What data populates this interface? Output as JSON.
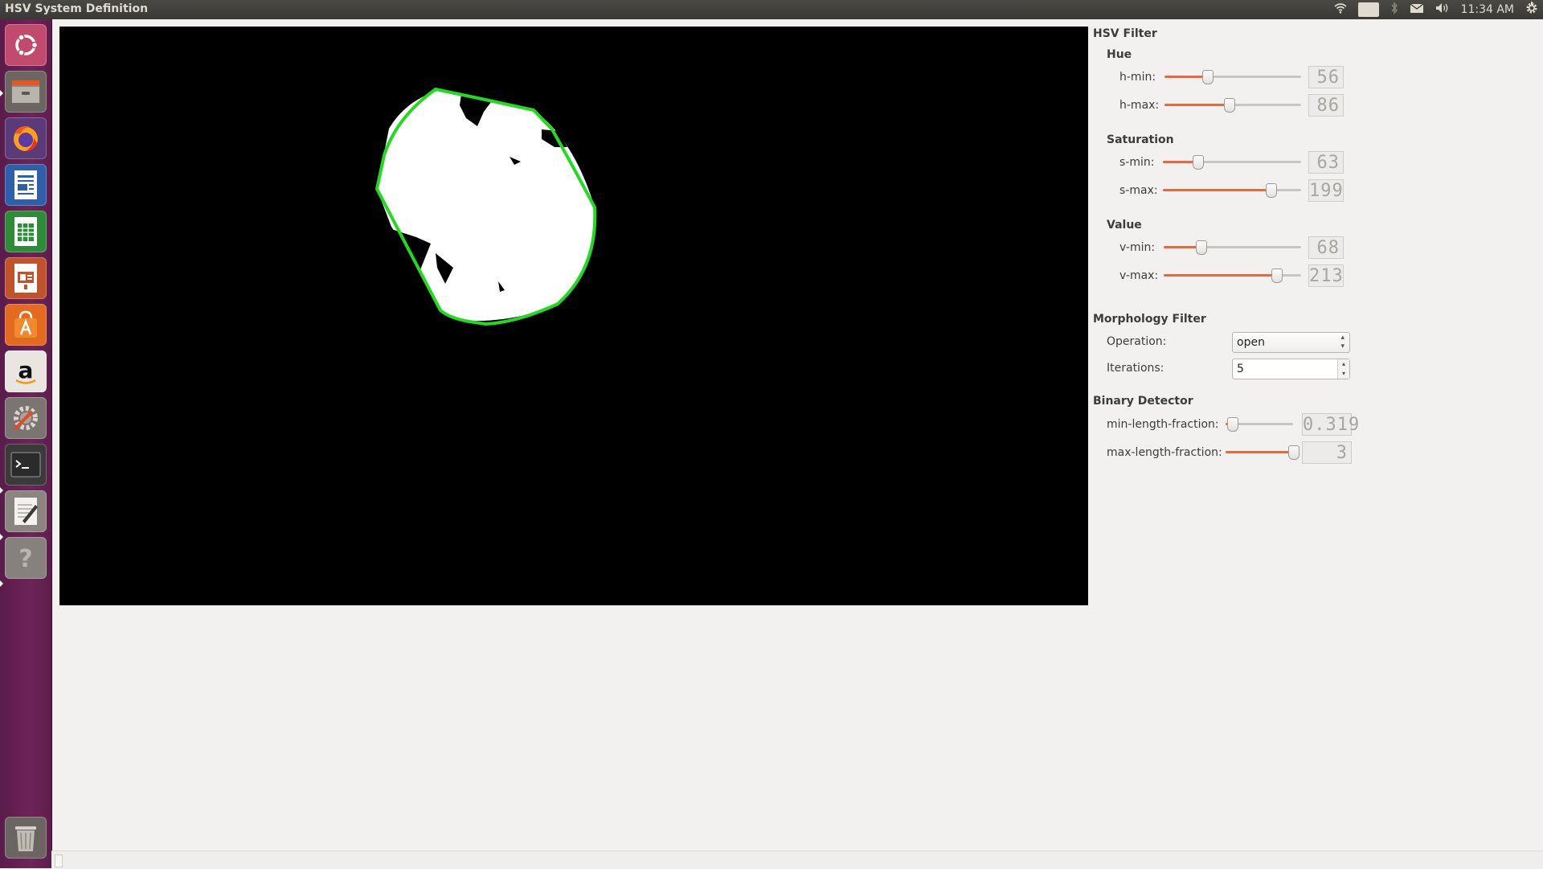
{
  "window": {
    "title": "HSV System Definition"
  },
  "topbar": {
    "keyboard_layout": "En",
    "clock": "11:34 AM",
    "icons": [
      "wifi-icon",
      "keyboard-layout-icon",
      "bluetooth-icon",
      "mail-icon",
      "volume-icon",
      "settings-gear-icon"
    ]
  },
  "launcher": {
    "items": [
      "ubuntu-dash",
      "files",
      "firefox",
      "libreoffice-writer",
      "libreoffice-calc",
      "libreoffice-impress",
      "ubuntu-software",
      "amazon",
      "system-settings",
      "terminal",
      "text-editor",
      "help"
    ],
    "trash": "trash"
  },
  "colors": {
    "contour": "#1fdc1f",
    "accent": "#e8683f",
    "launcher": "#6d2458"
  },
  "hsv_filter": {
    "title": "HSV Filter",
    "hue": {
      "title": "Hue",
      "h_min": {
        "label": "h-min:",
        "value": "56",
        "level": 0.31
      },
      "h_max": {
        "label": "h-max:",
        "value": "86",
        "level": 0.47
      }
    },
    "saturation": {
      "title": "Saturation",
      "s_min": {
        "label": "s-min:",
        "value": "63",
        "level": 0.25
      },
      "s_max": {
        "label": "s-max:",
        "value": "199",
        "level": 0.78
      }
    },
    "value": {
      "title": "Value",
      "v_min": {
        "label": "v-min:",
        "value": "68",
        "level": 0.27
      },
      "v_max": {
        "label": "v-max:",
        "value": "213",
        "level": 0.82
      }
    }
  },
  "morphology_filter": {
    "title": "Morphology Filter",
    "operation_label": "Operation:",
    "operation_value": "open",
    "iterations_label": "Iterations:",
    "iterations_value": "5"
  },
  "binary_detector": {
    "title": "Binary Detector",
    "min_length": {
      "label": "min-length-fraction:",
      "value": "0.319",
      "level": 0.1
    },
    "max_length": {
      "label": "max-length-fraction:",
      "value": "3",
      "level": 1.0
    }
  }
}
